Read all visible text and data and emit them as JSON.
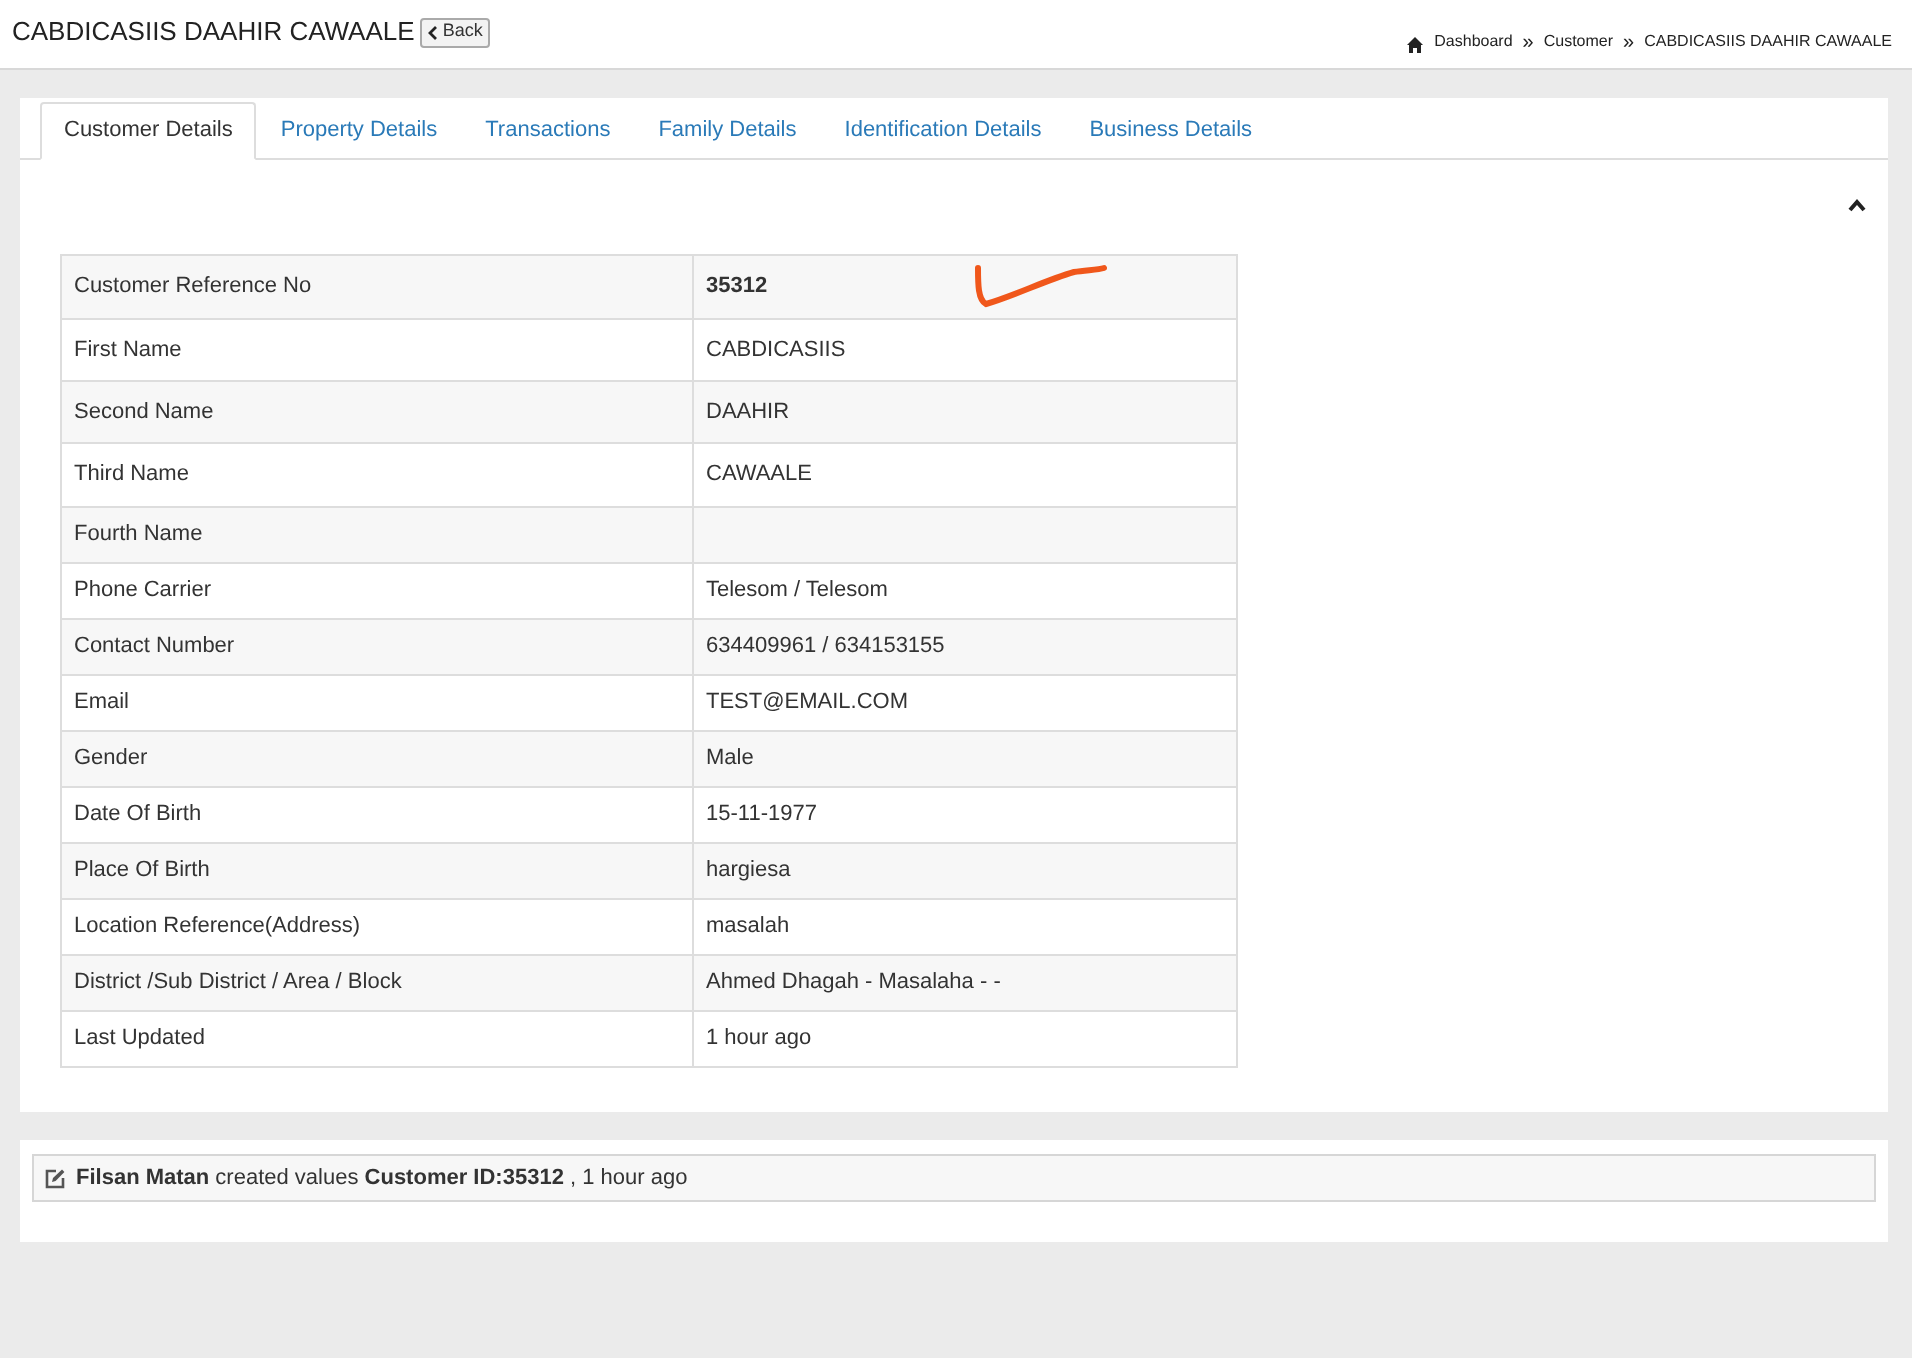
{
  "header": {
    "title": "CABDICASIIS DAAHIR CAWAALE",
    "back_button": "Back",
    "breadcrumb": [
      "Dashboard",
      "Customer",
      "CABDICASIIS DAAHIR CAWAALE"
    ],
    "separator": "»"
  },
  "tabs": [
    {
      "label": "Customer Details",
      "selected": true
    },
    {
      "label": "Property Details",
      "selected": false
    },
    {
      "label": "Transactions",
      "selected": false
    },
    {
      "label": "Family Details",
      "selected": false
    },
    {
      "label": "Identification Details",
      "selected": false
    },
    {
      "label": "Business Details",
      "selected": false
    }
  ],
  "details": [
    {
      "label": "Customer Reference No",
      "value": "35312",
      "bold": true
    },
    {
      "label": "First Name",
      "value": "CABDICASIIS"
    },
    {
      "label": "Second Name",
      "value": "DAAHIR"
    },
    {
      "label": "Third Name",
      "value": "CAWAALE"
    },
    {
      "label": "Fourth Name"
    },
    {
      "label": "Phone Carrier",
      "value": "Telesom / Telesom"
    },
    {
      "label": "Contact Number",
      "value": "634409961 / 634153155"
    },
    {
      "label": "Email",
      "value": "TEST@EMAIL.COM"
    },
    {
      "label": "Gender",
      "value": "Male"
    },
    {
      "label": "Date Of Birth",
      "value": "15-11-1977"
    },
    {
      "label": "Place Of Birth",
      "value": "hargiesa"
    },
    {
      "label": "Location Reference(Address)",
      "value": "masalah"
    },
    {
      "label": "District /Sub District / Area / Block",
      "value": "Ahmed Dhagah - Masalaha - -"
    },
    {
      "label": "Last Updated",
      "value": "1 hour ago"
    }
  ],
  "activity": {
    "text": "**Filsan Matan** created values **Customer ID:35312** , 1 hour ago"
  }
}
